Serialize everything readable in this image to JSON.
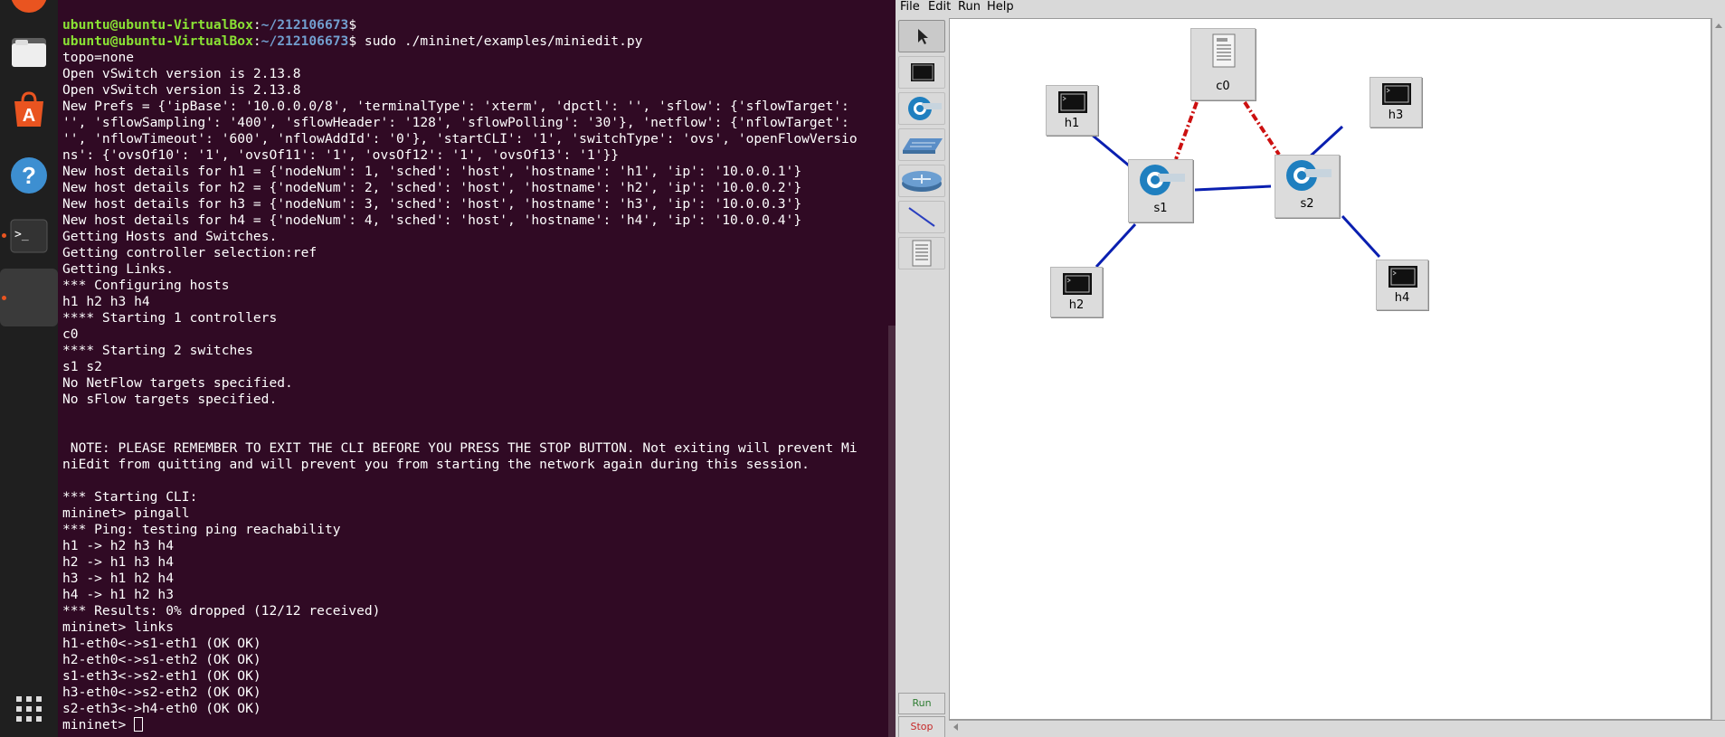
{
  "terminal": {
    "prompt_user": "ubuntu@ubuntu-VirtualBox",
    "prompt_path": "~/212106673",
    "command": "sudo ./mininet/examples/miniedit.py",
    "output": [
      "topo=none",
      "Open vSwitch version is 2.13.8",
      "Open vSwitch version is 2.13.8",
      "New Prefs = {'ipBase': '10.0.0.0/8', 'terminalType': 'xterm', 'dpctl': '', 'sflow': {'sflowTarget':",
      "'', 'sflowSampling': '400', 'sflowHeader': '128', 'sflowPolling': '30'}, 'netflow': {'nflowTarget':",
      "'', 'nflowTimeout': '600', 'nflowAddId': '0'}, 'startCLI': '1', 'switchType': 'ovs', 'openFlowVersio",
      "ns': {'ovsOf10': '1', 'ovsOf11': '1', 'ovsOf12': '1', 'ovsOf13': '1'}}",
      "New host details for h1 = {'nodeNum': 1, 'sched': 'host', 'hostname': 'h1', 'ip': '10.0.0.1'}",
      "New host details for h2 = {'nodeNum': 2, 'sched': 'host', 'hostname': 'h2', 'ip': '10.0.0.2'}",
      "New host details for h3 = {'nodeNum': 3, 'sched': 'host', 'hostname': 'h3', 'ip': '10.0.0.3'}",
      "New host details for h4 = {'nodeNum': 4, 'sched': 'host', 'hostname': 'h4', 'ip': '10.0.0.4'}",
      "Getting Hosts and Switches.",
      "Getting controller selection:ref",
      "Getting Links.",
      "*** Configuring hosts",
      "h1 h2 h3 h4",
      "**** Starting 1 controllers",
      "c0",
      "**** Starting 2 switches",
      "s1 s2",
      "No NetFlow targets specified.",
      "No sFlow targets specified.",
      "",
      "",
      " NOTE: PLEASE REMEMBER TO EXIT THE CLI BEFORE YOU PRESS THE STOP BUTTON. Not exiting will prevent Mi",
      "niEdit from quitting and will prevent you from starting the network again during this session.",
      "",
      "*** Starting CLI:",
      "mininet> pingall",
      "*** Ping: testing ping reachability",
      "h1 -> h2 h3 h4",
      "h2 -> h1 h3 h4",
      "h3 -> h1 h2 h4",
      "h4 -> h1 h2 h3",
      "*** Results: 0% dropped (12/12 received)",
      "mininet> links",
      "h1-eth0<->s1-eth1 (OK OK)",
      "h2-eth0<->s1-eth2 (OK OK)",
      "s1-eth3<->s2-eth1 (OK OK)",
      "h3-eth0<->s2-eth2 (OK OK)",
      "s2-eth3<->h4-eth0 (OK OK)"
    ],
    "last_prompt": "mininet> "
  },
  "miniedit": {
    "menu": [
      "File",
      "Edit",
      "Run",
      "Help"
    ],
    "run_label": "Run",
    "stop_label": "Stop",
    "nodes": {
      "h1": "h1",
      "h2": "h2",
      "h3": "h3",
      "h4": "h4",
      "s1": "s1",
      "s2": "s2",
      "c0": "c0"
    }
  },
  "colors": {
    "terminal_bg": "#300a24",
    "prompt_user": "#8ae234",
    "prompt_path": "#729fcf",
    "link": "#0a1fb0",
    "controller_link": "#cc1010",
    "run_text": "#2e7d32",
    "stop_text": "#c62828"
  }
}
